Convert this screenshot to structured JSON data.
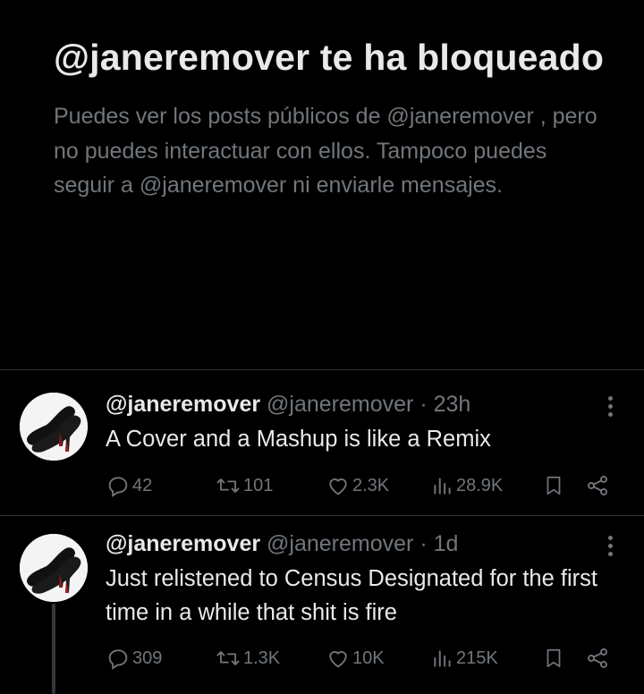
{
  "blocked_notice": {
    "title": "@janeremover te ha bloqueado",
    "message": "Puedes ver los posts públicos de @janeremover , pero no puedes interactuar con ellos. Tampoco puedes seguir a @janeremover ni enviarle mensajes."
  },
  "posts": [
    {
      "display_name": "@janeremover",
      "handle": "@janeremover",
      "separator": "·",
      "time": "23h",
      "text": "A Cover and a Mashup is like a Remix",
      "replies": "42",
      "reposts": "101",
      "likes": "2.3K",
      "views": "28.9K"
    },
    {
      "display_name": "@janeremover",
      "handle": "@janeremover",
      "separator": "·",
      "time": "1d",
      "text": "Just relistened to Census Designated for the first time in a while that shit is fire",
      "replies": "309",
      "reposts": "1.3K",
      "likes": "10K",
      "views": "215K"
    }
  ],
  "colors": {
    "background": "#000000",
    "primary_text": "#e7e9ea",
    "secondary_text": "#71767b",
    "divider": "#2f3336"
  }
}
